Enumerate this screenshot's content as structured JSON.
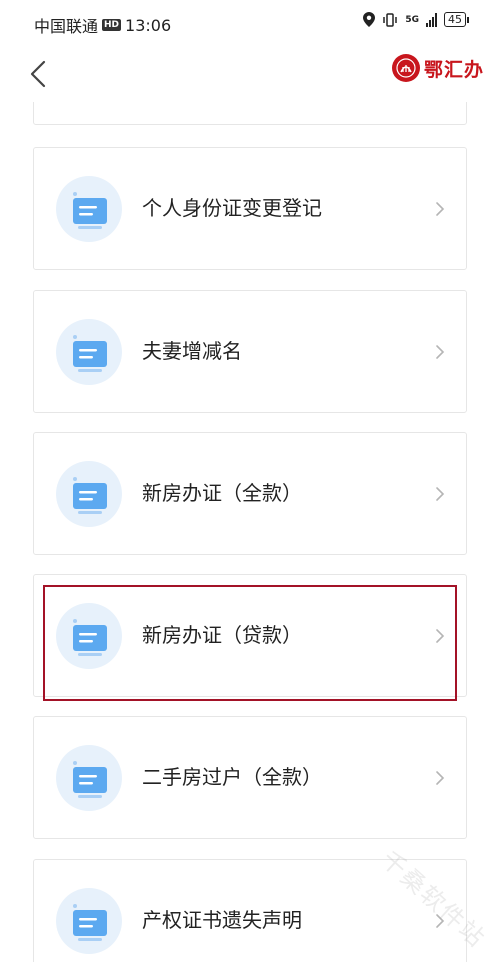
{
  "status_bar": {
    "carrier": "中国联通",
    "hd": "HD",
    "time": "13:06",
    "network": "5G",
    "battery": "45"
  },
  "header": {
    "brand_name": "鄂汇办"
  },
  "services": [
    {
      "label": "个人身份证变更登记"
    },
    {
      "label": "夫妻增减名"
    },
    {
      "label": "新房办证（全款）"
    },
    {
      "label": "新房办证（贷款）"
    },
    {
      "label": "二手房过户（全款）"
    },
    {
      "label": "产权证书遗失声明"
    }
  ],
  "watermark": "千桑软件站",
  "colors": {
    "brand": "#c8161d",
    "highlight": "#a31227",
    "icon_bg": "#e7f1fb",
    "icon_fg": "#5ca9f0"
  }
}
